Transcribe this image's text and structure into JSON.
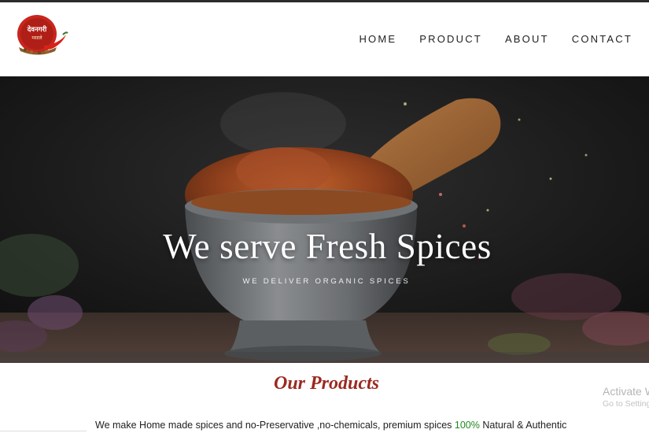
{
  "header": {
    "logo": {
      "text_line1": "देवनगरी",
      "text_line2": "मसाले",
      "icon": "chili-logo-icon"
    },
    "nav": [
      {
        "label": "HOME"
      },
      {
        "label": "PRODUCT"
      },
      {
        "label": "ABOUT"
      },
      {
        "label": "CONTACT"
      }
    ]
  },
  "hero": {
    "title": "We serve Fresh Spices",
    "subtitle": "WE DELIVER ORGANIC SPICES",
    "image": "mortar-and-pestle-with-spices"
  },
  "products": {
    "title": "Our Products",
    "description_before": "We make Home made spices and no-Preservative ,no-chemicals, premium spices ",
    "description_highlight": "100%",
    "description_after": " Natural & Authentic"
  },
  "watermark": {
    "line1": "Activate Windows",
    "line2": "Go to Settings to activate Windows."
  },
  "colors": {
    "accent_red": "#9a2a20",
    "highlight_green": "#1e8a1e",
    "logo_red": "#c8261d"
  }
}
